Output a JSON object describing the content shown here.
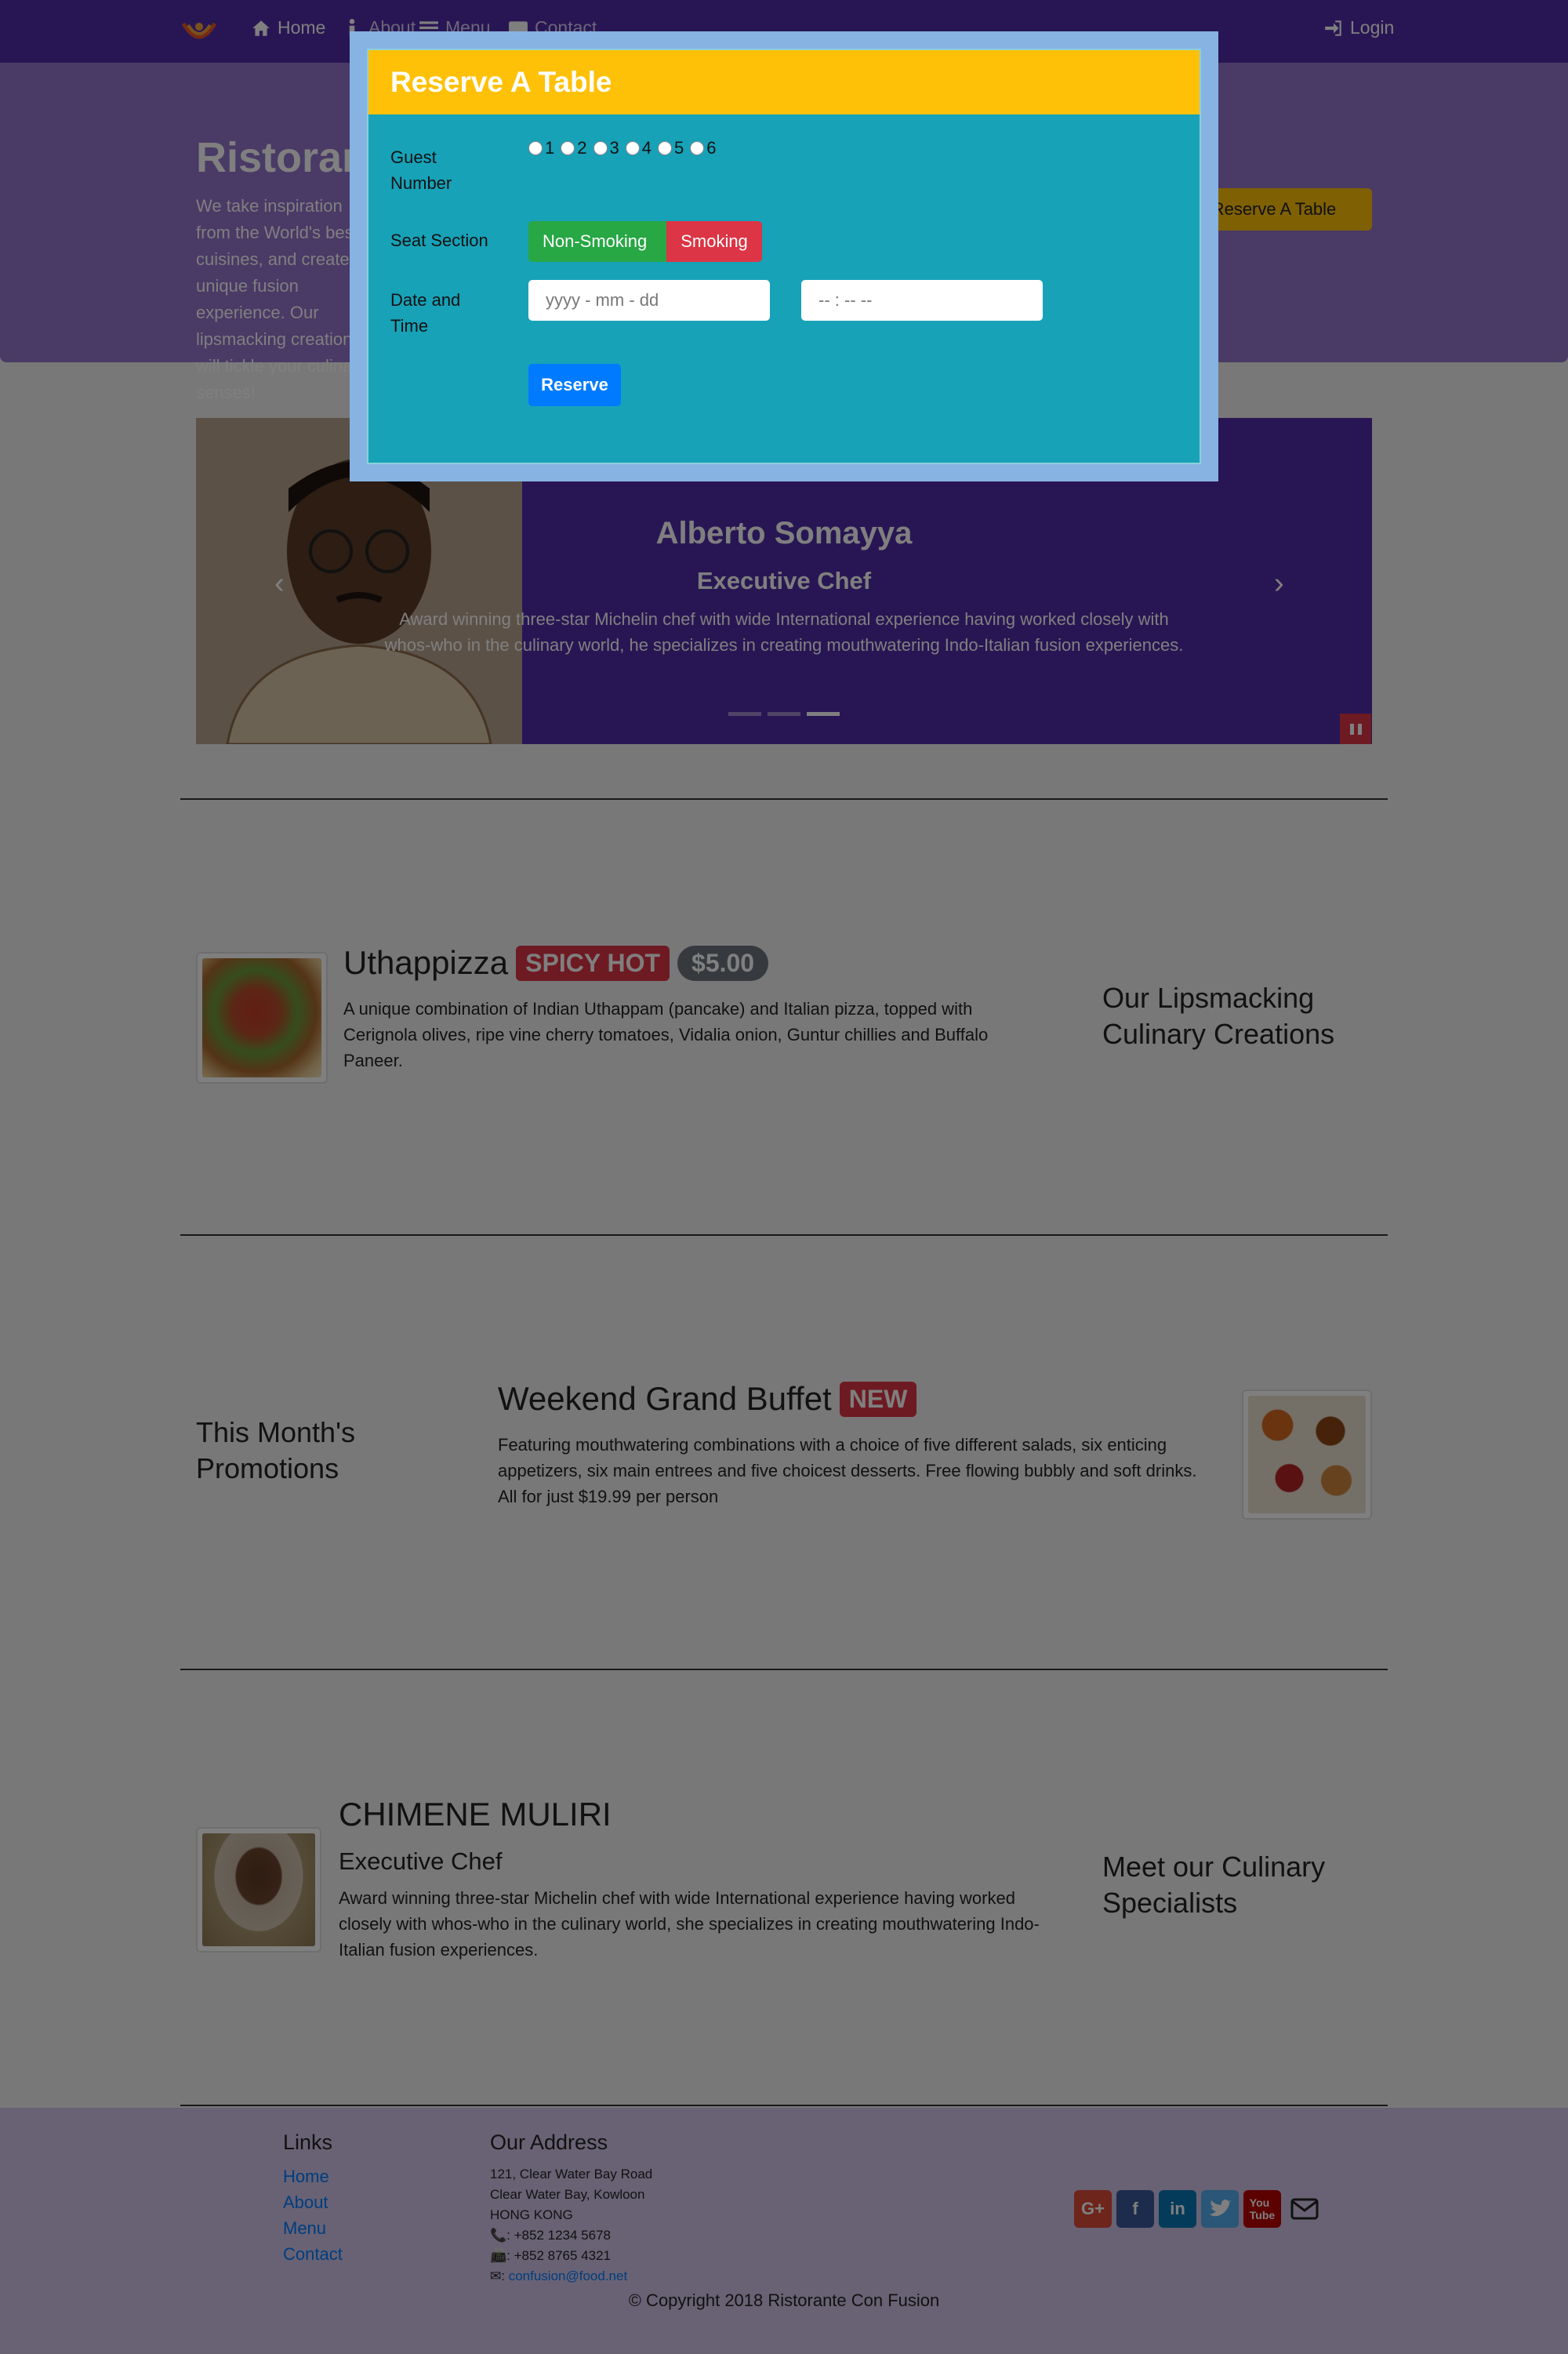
{
  "navbar": {
    "home": "Home",
    "about": "About",
    "menu": "Menu",
    "contact": "Contact",
    "login": "Login"
  },
  "jumbotron": {
    "title": "Ristorante con Fusion",
    "text": "We take inspiration from the World's best cuisines, and create a unique fusion experience. Our lipsmacking creations will tickle your culinary senses!",
    "reserve_button": "Reserve A Table"
  },
  "carousel": {
    "name": "Alberto Somayya",
    "role": "Executive Chef",
    "description": "Award winning three-star Michelin chef with wide International experience having worked closely with whos-who in the culinary world, he specializes in creating mouthwatering Indo-Italian fusion experiences.",
    "active_slide": 3
  },
  "dish": {
    "name": "Uthappizza",
    "badge": "SPICY HOT",
    "price": "$5.00",
    "description": "A unique combination of Indian Uthappam (pancake) and Italian pizza, topped with Cerignola olives, ripe vine cherry tomatoes, Vidalia onion, Guntur chillies and Buffalo Paneer.",
    "side_heading": "Our Lipsmacking Culinary Creations"
  },
  "promotion": {
    "side_heading": "This Month's Promotions",
    "name": "Weekend Grand Buffet",
    "badge": "NEW",
    "description": "Featuring mouthwatering combinations with a choice of five different salads, six enticing appetizers, six main entrees and five choicest desserts. Free flowing bubbly and soft drinks. All for just $19.99 per person"
  },
  "leader": {
    "name": "CHIMENE MULIRI",
    "role": "Executive Chef",
    "description": "Award winning three-star Michelin chef with wide International experience having worked closely with whos-who in the culinary world, she specializes in creating mouthwatering Indo-Italian fusion experiences.",
    "side_heading": "Meet our Culinary Specialists"
  },
  "footer": {
    "links_heading": "Links",
    "links": [
      "Home",
      "About",
      "Menu",
      "Contact"
    ],
    "address_heading": "Our Address",
    "address_lines": [
      "121, Clear Water Bay Road",
      "Clear Water Bay, Kowloon",
      "HONG KONG"
    ],
    "phone": ": +852 1234 5678",
    "fax": ": +852 8765 4321",
    "email_prefix": ": ",
    "email": "confusion@food.net",
    "copyright": "© Copyright 2018 Ristorante Con Fusion"
  },
  "modal": {
    "title": "Reserve A Table",
    "guest_label": "Guest Number",
    "guest_options": [
      "1",
      "2",
      "3",
      "4",
      "5",
      "6"
    ],
    "seat_label": "Seat Section",
    "seat_options": [
      "Non-Smoking",
      "Smoking"
    ],
    "datetime_label": "Date and Time",
    "date_placeholder": "yyyy - mm - dd",
    "time_placeholder": "-- : --   --",
    "reserve_button": "Reserve"
  },
  "colors": {
    "primary": "#512da8",
    "jumbotron": "#9575cd",
    "footer": "#d1c4e9",
    "modal_header": "#ffc107",
    "modal_body": "#17a2b8"
  }
}
